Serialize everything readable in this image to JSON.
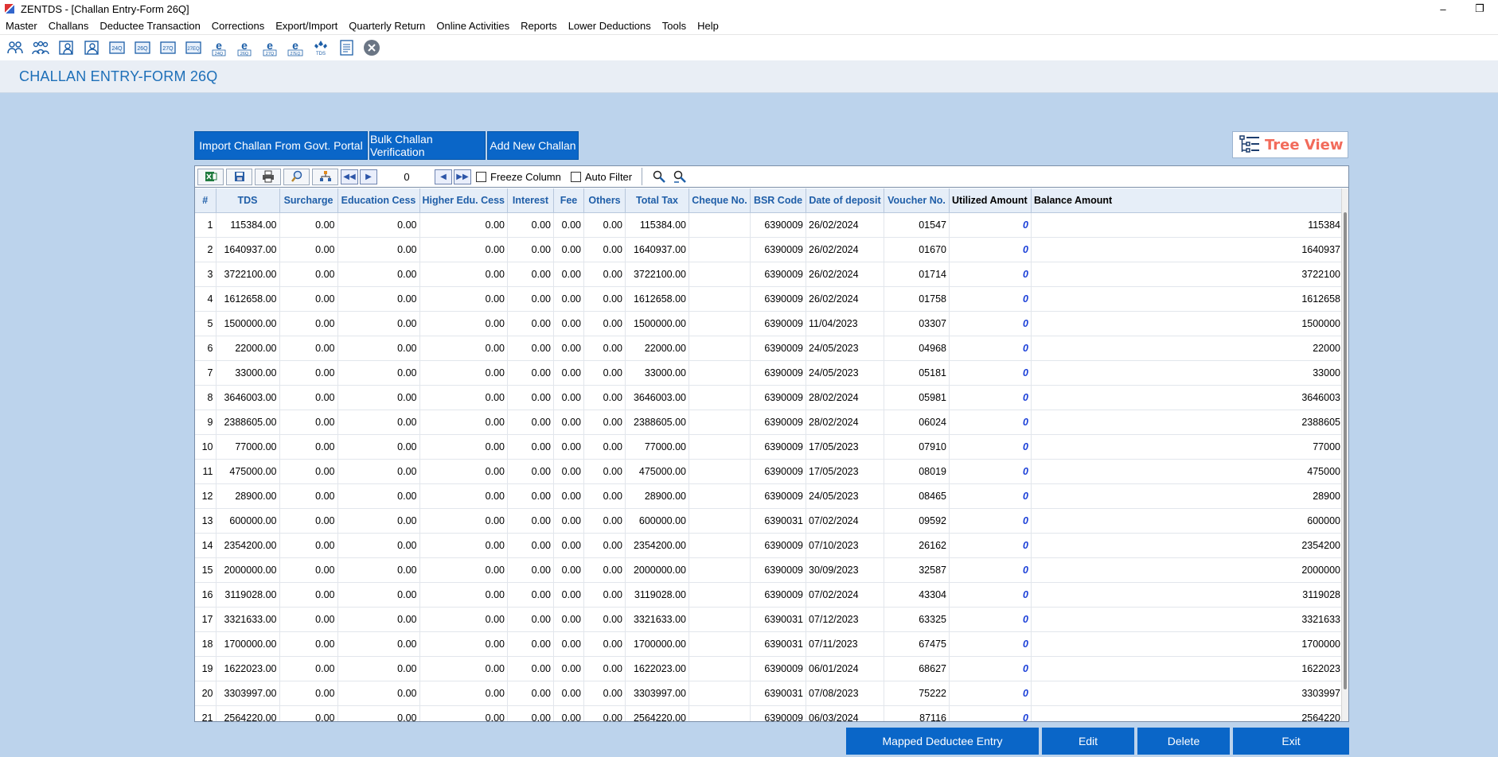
{
  "window": {
    "title": "ZENTDS - [Challan Entry-Form 26Q]",
    "minimize": "–",
    "restore": "❐"
  },
  "menu": [
    "Master",
    "Challans",
    "Deductee Transaction",
    "Corrections",
    "Export/Import",
    "Quarterly Return",
    "Online Activities",
    "Reports",
    "Lower Deductions",
    "Tools",
    "Help"
  ],
  "toolbar_icons": [
    "user-icon",
    "users-group-icon",
    "deductor-icon",
    "deductee-icon",
    "form-24q-icon",
    "form-26q-icon",
    "form-27q-icon",
    "form-27eq-icon",
    "e-24q-icon",
    "e-26q-icon",
    "e-27q-icon",
    "e-27eq-icon",
    "tds-icon",
    "report-icon",
    "close-icon"
  ],
  "page": {
    "title": "CHALLAN ENTRY-FORM 26Q"
  },
  "actions": {
    "import": "Import Challan From Govt. Portal",
    "bulk": "Bulk Challan Verification",
    "add": "Add New Challan",
    "tree_view": "Tree View"
  },
  "grid_toolbar": {
    "record_count": "0",
    "freeze_column": "Freeze Column",
    "auto_filter": "Auto Filter"
  },
  "table": {
    "columns": [
      "#",
      "TDS",
      "Surcharge",
      "Education Cess",
      "Higher Edu. Cess",
      "Interest",
      "Fee",
      "Others",
      "Total Tax",
      "Cheque No.",
      "BSR Code",
      "Date of deposit",
      "Voucher No.",
      "Utilized Amount",
      "Balance Amount"
    ],
    "rows": [
      [
        "1",
        "115384.00",
        "0.00",
        "0.00",
        "0.00",
        "0.00",
        "0.00",
        "0.00",
        "115384.00",
        "",
        "6390009",
        "26/02/2024",
        "01547",
        "0",
        "115384"
      ],
      [
        "2",
        "1640937.00",
        "0.00",
        "0.00",
        "0.00",
        "0.00",
        "0.00",
        "0.00",
        "1640937.00",
        "",
        "6390009",
        "26/02/2024",
        "01670",
        "0",
        "1640937"
      ],
      [
        "3",
        "3722100.00",
        "0.00",
        "0.00",
        "0.00",
        "0.00",
        "0.00",
        "0.00",
        "3722100.00",
        "",
        "6390009",
        "26/02/2024",
        "01714",
        "0",
        "3722100"
      ],
      [
        "4",
        "1612658.00",
        "0.00",
        "0.00",
        "0.00",
        "0.00",
        "0.00",
        "0.00",
        "1612658.00",
        "",
        "6390009",
        "26/02/2024",
        "01758",
        "0",
        "1612658"
      ],
      [
        "5",
        "1500000.00",
        "0.00",
        "0.00",
        "0.00",
        "0.00",
        "0.00",
        "0.00",
        "1500000.00",
        "",
        "6390009",
        "11/04/2023",
        "03307",
        "0",
        "1500000"
      ],
      [
        "6",
        "22000.00",
        "0.00",
        "0.00",
        "0.00",
        "0.00",
        "0.00",
        "0.00",
        "22000.00",
        "",
        "6390009",
        "24/05/2023",
        "04968",
        "0",
        "22000"
      ],
      [
        "7",
        "33000.00",
        "0.00",
        "0.00",
        "0.00",
        "0.00",
        "0.00",
        "0.00",
        "33000.00",
        "",
        "6390009",
        "24/05/2023",
        "05181",
        "0",
        "33000"
      ],
      [
        "8",
        "3646003.00",
        "0.00",
        "0.00",
        "0.00",
        "0.00",
        "0.00",
        "0.00",
        "3646003.00",
        "",
        "6390009",
        "28/02/2024",
        "05981",
        "0",
        "3646003"
      ],
      [
        "9",
        "2388605.00",
        "0.00",
        "0.00",
        "0.00",
        "0.00",
        "0.00",
        "0.00",
        "2388605.00",
        "",
        "6390009",
        "28/02/2024",
        "06024",
        "0",
        "2388605"
      ],
      [
        "10",
        "77000.00",
        "0.00",
        "0.00",
        "0.00",
        "0.00",
        "0.00",
        "0.00",
        "77000.00",
        "",
        "6390009",
        "17/05/2023",
        "07910",
        "0",
        "77000"
      ],
      [
        "11",
        "475000.00",
        "0.00",
        "0.00",
        "0.00",
        "0.00",
        "0.00",
        "0.00",
        "475000.00",
        "",
        "6390009",
        "17/05/2023",
        "08019",
        "0",
        "475000"
      ],
      [
        "12",
        "28900.00",
        "0.00",
        "0.00",
        "0.00",
        "0.00",
        "0.00",
        "0.00",
        "28900.00",
        "",
        "6390009",
        "24/05/2023",
        "08465",
        "0",
        "28900"
      ],
      [
        "13",
        "600000.00",
        "0.00",
        "0.00",
        "0.00",
        "0.00",
        "0.00",
        "0.00",
        "600000.00",
        "",
        "6390031",
        "07/02/2024",
        "09592",
        "0",
        "600000"
      ],
      [
        "14",
        "2354200.00",
        "0.00",
        "0.00",
        "0.00",
        "0.00",
        "0.00",
        "0.00",
        "2354200.00",
        "",
        "6390009",
        "07/10/2023",
        "26162",
        "0",
        "2354200"
      ],
      [
        "15",
        "2000000.00",
        "0.00",
        "0.00",
        "0.00",
        "0.00",
        "0.00",
        "0.00",
        "2000000.00",
        "",
        "6390009",
        "30/09/2023",
        "32587",
        "0",
        "2000000"
      ],
      [
        "16",
        "3119028.00",
        "0.00",
        "0.00",
        "0.00",
        "0.00",
        "0.00",
        "0.00",
        "3119028.00",
        "",
        "6390009",
        "07/02/2024",
        "43304",
        "0",
        "3119028"
      ],
      [
        "17",
        "3321633.00",
        "0.00",
        "0.00",
        "0.00",
        "0.00",
        "0.00",
        "0.00",
        "3321633.00",
        "",
        "6390031",
        "07/12/2023",
        "63325",
        "0",
        "3321633"
      ],
      [
        "18",
        "1700000.00",
        "0.00",
        "0.00",
        "0.00",
        "0.00",
        "0.00",
        "0.00",
        "1700000.00",
        "",
        "6390031",
        "07/11/2023",
        "67475",
        "0",
        "1700000"
      ],
      [
        "19",
        "1622023.00",
        "0.00",
        "0.00",
        "0.00",
        "0.00",
        "0.00",
        "0.00",
        "1622023.00",
        "",
        "6390009",
        "06/01/2024",
        "68627",
        "0",
        "1622023"
      ],
      [
        "20",
        "3303997.00",
        "0.00",
        "0.00",
        "0.00",
        "0.00",
        "0.00",
        "0.00",
        "3303997.00",
        "",
        "6390031",
        "07/08/2023",
        "75222",
        "0",
        "3303997"
      ],
      [
        "21",
        "2564220.00",
        "0.00",
        "0.00",
        "0.00",
        "0.00",
        "0.00",
        "0.00",
        "2564220.00",
        "",
        "6390009",
        "06/03/2024",
        "87116",
        "0",
        "2564220"
      ]
    ]
  },
  "bottom": {
    "mapped": "Mapped Deductee Entry",
    "edit": "Edit",
    "delete": "Delete",
    "exit": "Exit"
  }
}
